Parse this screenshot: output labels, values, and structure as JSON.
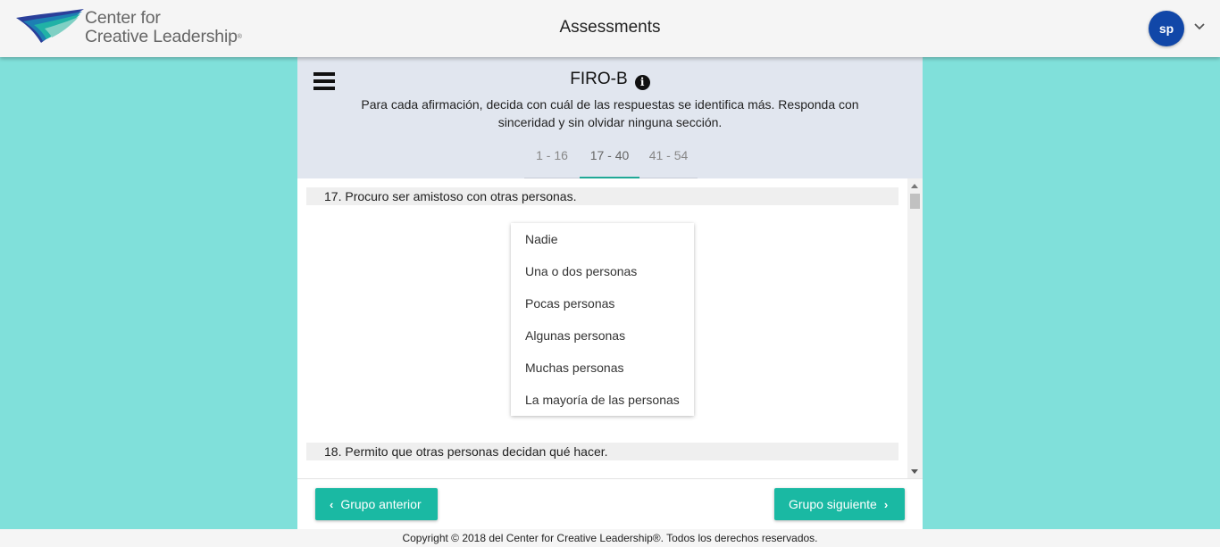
{
  "header": {
    "logo_text_line1": "Center for",
    "logo_text_line2": "Creative Leadership",
    "logo_trademark": "®",
    "title": "Assessments",
    "avatar_initials": "sp"
  },
  "assessment": {
    "name": "FIRO-B",
    "instructions": "Para cada afirmación, decida con cuál de las respuestas se identifica más. Responda con sinceridad y sin olvidar ninguna sección.",
    "tabs": [
      {
        "label": "1 - 16",
        "active": false
      },
      {
        "label": "17 - 40",
        "active": true
      },
      {
        "label": "41 - 54",
        "active": false
      }
    ]
  },
  "questions": [
    {
      "text": "17.  Procuro ser amistoso con otras personas.",
      "options": [
        "Nadie",
        "Una o dos personas",
        "Pocas personas",
        "Algunas personas",
        "Muchas personas",
        "La mayoría de las personas"
      ]
    },
    {
      "text": "18.  Permito que otras personas decidan qué hacer."
    }
  ],
  "nav": {
    "prev_label": "Grupo anterior",
    "next_label": "Grupo siguiente"
  },
  "footer": {
    "copyright": "Copyright © 2018 del Center for Creative Leadership®. Todos los derechos reservados."
  },
  "colors": {
    "page_bg": "#80e0da",
    "header_band": "#e1e6ef",
    "accent": "#1ab9a3",
    "avatar": "#1147a8"
  },
  "icons": [
    "logo-wing-icon",
    "chevron-down-icon",
    "menu-icon",
    "info-icon",
    "chevron-left-icon",
    "chevron-right-icon"
  ]
}
